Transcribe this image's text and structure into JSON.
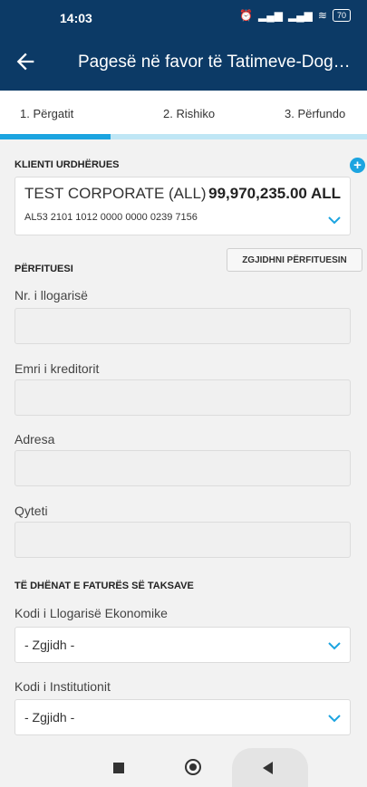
{
  "status": {
    "time": "14:03",
    "battery": "70"
  },
  "header": {
    "title": "Pagesë në favor të Tatimeve-Dogan..."
  },
  "steps": [
    {
      "label": "1. Përgatit"
    },
    {
      "label": "2. Rishiko"
    },
    {
      "label": "3. Përfundo"
    }
  ],
  "progress": {
    "current_step": 1,
    "total_steps": 3
  },
  "client": {
    "section_title": "KLIENTI URDHËRUES",
    "name": "TEST CORPORATE (ALL)",
    "amount": "99,970,235.00 ALL",
    "iban": "AL53 2101 1012 0000 0000 0239 7156"
  },
  "beneficiary": {
    "section_title": "PËRFITUESI",
    "choose_label": "ZGJIDHNI PËRFITUESIN",
    "fields": [
      {
        "label": "Nr. i llogarisë",
        "value": ""
      },
      {
        "label": "Emri i kreditorit",
        "value": ""
      },
      {
        "label": "Adresa",
        "value": ""
      },
      {
        "label": "Qyteti",
        "value": ""
      }
    ]
  },
  "invoice": {
    "section_title": "TË DHËNAT E FATURËS SË TAKSAVE",
    "economic_code_label": "Kodi i Llogarisë Ekonomike",
    "economic_code_value": "- Zgjidh -",
    "institution_code_label": "Kodi i Institutionit",
    "institution_code_value": "- Zgjidh -"
  },
  "colors": {
    "primary": "#0c3a66",
    "accent": "#1ca4e0",
    "progress_track": "#bfe6f5"
  }
}
